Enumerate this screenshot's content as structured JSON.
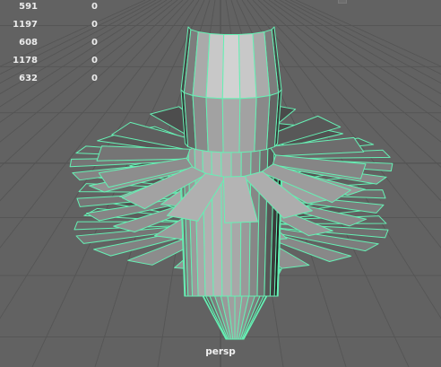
{
  "viewport": {
    "camera": "persp",
    "wireframe_color": "#66f0b4",
    "background_color": "#626262",
    "grid_color": "#555555"
  },
  "hud": {
    "rows": [
      {
        "a": "591",
        "b": "0"
      },
      {
        "a": "1197",
        "b": "0"
      },
      {
        "a": "608",
        "b": "0"
      },
      {
        "a": "1178",
        "b": "0"
      },
      {
        "a": "632",
        "b": "0"
      }
    ]
  }
}
